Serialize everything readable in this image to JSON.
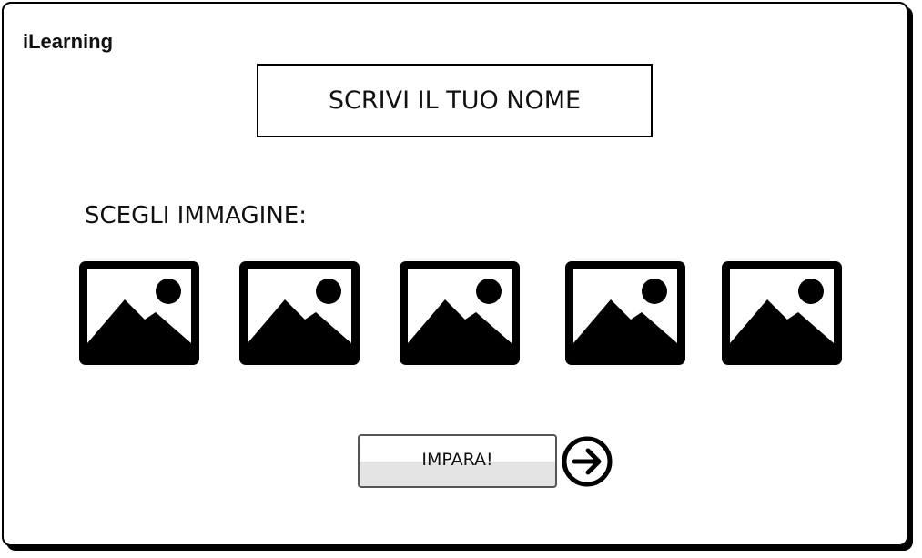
{
  "app": {
    "title": "iLearning"
  },
  "form": {
    "name_placeholder": "SCRIVI IL TUO NOME",
    "choose_image_label": "SCEGLI IMMAGINE:",
    "image_options": [
      {
        "icon": "image-placeholder-icon"
      },
      {
        "icon": "image-placeholder-icon"
      },
      {
        "icon": "image-placeholder-icon"
      },
      {
        "icon": "image-placeholder-icon"
      },
      {
        "icon": "image-placeholder-icon"
      }
    ],
    "learn_button_label": "IMPARA!",
    "next_icon": "arrow-right-circle-icon"
  },
  "colors": {
    "stroke": "#000000",
    "background": "#ffffff",
    "button_bottom": "#e4e4e4"
  }
}
